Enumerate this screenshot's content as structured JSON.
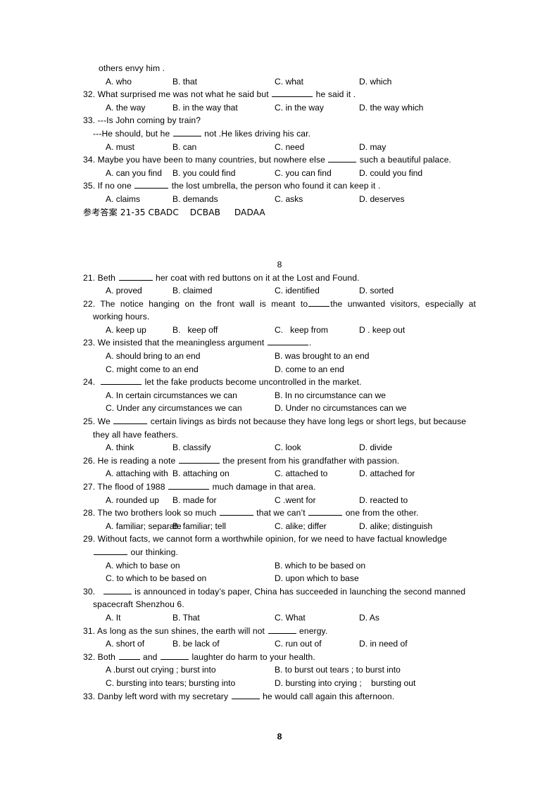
{
  "document": {
    "page_number_footer": "8",
    "page_marker_mid": "8",
    "answer_key": {
      "label": "参考答案",
      "range": "21-35",
      "groups": "CBADC    DCBAB     DADAA",
      "full": "参考答案 21-35 CBADC    DCBAB     DADAA"
    }
  },
  "top_section": {
    "q31_tail": "others envy him .",
    "q31_options": {
      "a": "A. who",
      "b": "B. that",
      "c": "C. what",
      "d": "D. which"
    },
    "q32": {
      "pre": "32. What surprised me was not what he said but ",
      "post": " he said it .",
      "options": {
        "a": "A. the way",
        "b": "B. in the way that",
        "c": "C. in the way",
        "d": "D. the way which"
      }
    },
    "q33": {
      "line1": "33. ---Is John coming by train?",
      "line2_pre": "---He should, but he ",
      "line2_post": " not .He likes driving his car.",
      "options": {
        "a": "A. must",
        "b": "B. can",
        "c": "C. need",
        "d": "D. may"
      }
    },
    "q34": {
      "pre": "34. Maybe you have been to many countries, but nowhere else ",
      "post": " such a beautiful palace.",
      "options": {
        "a": "A. can you find",
        "b": "B. you could find",
        "c": "C. you can find",
        "d": "D. could you find"
      }
    },
    "q35": {
      "pre": "35. If no one ",
      "post": " the lost umbrella, the person who found it can keep it .",
      "options": {
        "a": "A. claims",
        "b": "B. demands",
        "c": "C. asks",
        "d": "D. deserves"
      }
    }
  },
  "bottom_section": {
    "q21": {
      "pre": "21. Beth ",
      "post": " her coat with red buttons on it at the Lost and Found.",
      "options": {
        "a": "A. proved",
        "b": "B. claimed",
        "c": "C. identified",
        "d": "D. sorted"
      }
    },
    "q22": {
      "line1": "22. The notice hanging on the front wall is meant to ____ the unwanted visitors, especially at",
      "line1_a": "22. The notice hanging on the front wall is meant to",
      "line1_b": "the unwanted visitors, especially at",
      "line2": "working hours.",
      "options": {
        "a": "A. keep up",
        "b": "B.   keep off",
        "c": "C.   keep from",
        "d": "D . keep out"
      }
    },
    "q23": {
      "pre": "23. We insisted that the meaningless argument ",
      "post": ".",
      "options": {
        "a": "A. should bring to an end",
        "b": "B. was brought to an end",
        "c": "C. might come to an end",
        "d": "D. come to an end"
      }
    },
    "q24": {
      "pre": "24.  ",
      "post": " let the fake products become uncontrolled in the market.",
      "options": {
        "a": "A. In certain circumstances we can",
        "b": "B. In no circumstance can we",
        "c": "C. Under any circumstances we can",
        "d": "D. Under no circumstances can we"
      }
    },
    "q25": {
      "line1_pre": "25. We ",
      "line1_post": " certain livings as birds not because they have long legs or short legs, but because",
      "line2": "they all have feathers.",
      "options": {
        "a": "A. think",
        "b": "B. classify",
        "c": "C. look",
        "d": "D. divide"
      }
    },
    "q26": {
      "pre": "26. He is reading a note ",
      "post": " the present from his grandfather with passion.",
      "options": {
        "a": "A. attaching with",
        "b": "B. attaching on",
        "c": "C. attached to",
        "d": "D. attached for"
      }
    },
    "q27": {
      "pre": "27. The flood of 1988 ",
      "post": " much damage in that area.",
      "options": {
        "a": "A. rounded up",
        "b": "B. made for",
        "c": "C .went for",
        "d": "D. reacted to"
      }
    },
    "q28": {
      "pre": "28. The two brothers look so much ",
      "mid": " that we can’t ",
      "post": " one from the other.",
      "options": {
        "a": "A. familiar; separate",
        "b": "B. familiar; tell",
        "c": "C. alike; differ",
        "d": "D. alike; distinguish"
      }
    },
    "q29": {
      "line1": "29. Without facts, we cannot form a worthwhile opinion, for we need to have factual knowledge",
      "line2_post": " our thinking.",
      "options": {
        "a": "A. which to base on",
        "b": "B. which to be based on",
        "c": "C. to which to be based on",
        "d": "D. upon which to base"
      }
    },
    "q30": {
      "line1_pre": "30.   ",
      "line1_post": " is announced in today’s paper, China has succeeded in launching the second manned",
      "line2": "spacecraft Shenzhou 6.",
      "options": {
        "a": "A. It",
        "b": "B. That",
        "c": "C. What",
        "d": "D. As"
      }
    },
    "q31": {
      "pre": "31. As long as the sun shines, the earth will not ",
      "post": " energy.",
      "options": {
        "a": "A. short of",
        "b": "B. be lack of",
        "c": "C. run out of",
        "d": "D. in need of"
      }
    },
    "q32": {
      "pre": "32. Both ",
      "mid": " and ",
      "post": " laughter do harm to your health.",
      "options": {
        "a": "A .burst out crying ; burst into",
        "b": "B. to burst out tears ; to burst into",
        "c": "C. bursting into tears; bursting into",
        "d": "D. bursting into crying ;    bursting out"
      }
    },
    "q33": {
      "pre": "33. Danby left word with my secretary ",
      "post": " he would call again this afternoon."
    }
  }
}
